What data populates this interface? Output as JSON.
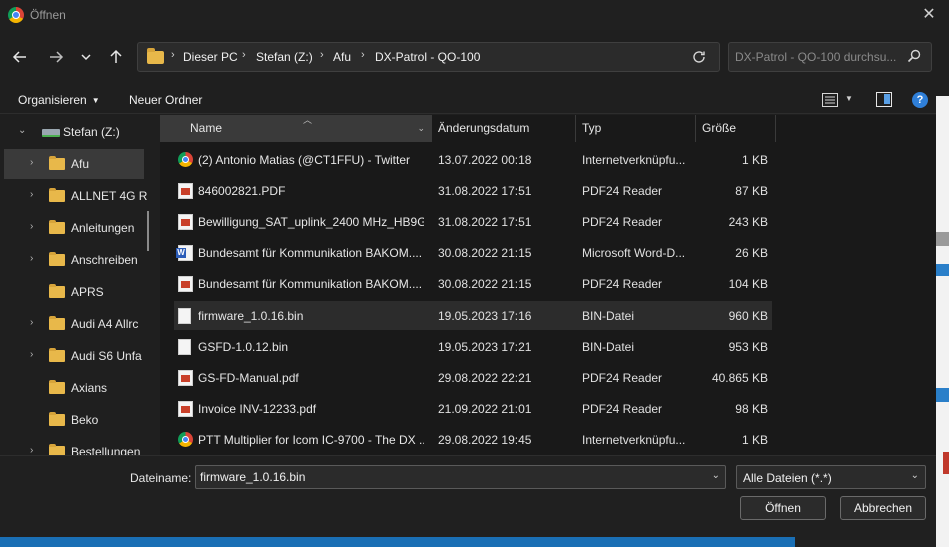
{
  "window": {
    "title": "Öffnen",
    "close_glyph": "✕"
  },
  "nav": {
    "back_glyph": "🡐",
    "forward_glyph": "🡒",
    "recent_glyph": "⌄",
    "up_glyph": "🡑",
    "breadcrumbs": [
      "Dieser PC",
      "Stefan (Z:)",
      "Afu",
      "DX-Patrol - QO-100"
    ],
    "separator": "›",
    "refresh_glyph": "↻",
    "search_placeholder": "DX-Patrol - QO-100 durchsu..."
  },
  "toolbar": {
    "organize_label": "Organisieren",
    "new_folder_label": "Neuer Ordner",
    "help_label": "?"
  },
  "sidebar": {
    "items": [
      {
        "label": "Stefan (Z:)",
        "expanded": true,
        "kind": "drive"
      },
      {
        "label": "Afu",
        "selected": true,
        "has_children": true
      },
      {
        "label": "ALLNET 4G R",
        "has_children": true
      },
      {
        "label": "Anleitungen",
        "has_children": true
      },
      {
        "label": "Anschreiben",
        "has_children": true
      },
      {
        "label": "APRS",
        "has_children": false
      },
      {
        "label": "Audi A4 Allrc",
        "has_children": true
      },
      {
        "label": "Audi S6 Unfa",
        "has_children": true
      },
      {
        "label": "Axians",
        "has_children": false
      },
      {
        "label": "Beko",
        "has_children": false
      },
      {
        "label": "Bestellungen",
        "has_children": true
      }
    ]
  },
  "file_list": {
    "columns": {
      "name": "Name",
      "date": "Änderungsdatum",
      "type": "Typ",
      "size": "Größe"
    },
    "rows": [
      {
        "icon": "chrome-icon",
        "name": "(2) Antonio Matias (@CT1FFU) - Twitter",
        "date": "13.07.2022 00:18",
        "type": "Internetverknüpfu...",
        "size": "1 KB"
      },
      {
        "icon": "pdf-icon",
        "name": "846002821.PDF",
        "date": "31.08.2022 17:51",
        "type": "PDF24 Reader",
        "size": "87 KB"
      },
      {
        "icon": "pdf-icon",
        "name": "Bewilligung_SAT_uplink_2400 MHz_HB9G...",
        "date": "31.08.2022 17:51",
        "type": "PDF24 Reader",
        "size": "243 KB"
      },
      {
        "icon": "word-icon",
        "name": "Bundesamt für Kommunikation BAKOM....",
        "date": "30.08.2022 21:15",
        "type": "Microsoft Word-D...",
        "size": "26 KB"
      },
      {
        "icon": "pdf-icon",
        "name": "Bundesamt für Kommunikation BAKOM....",
        "date": "30.08.2022 21:15",
        "type": "PDF24 Reader",
        "size": "104 KB"
      },
      {
        "icon": "file-icon",
        "name": "firmware_1.0.16.bin",
        "date": "19.05.2023 17:16",
        "type": "BIN-Datei",
        "size": "960 KB",
        "hover": true
      },
      {
        "icon": "file-icon",
        "name": "GSFD-1.0.12.bin",
        "date": "19.05.2023 17:21",
        "type": "BIN-Datei",
        "size": "953 KB"
      },
      {
        "icon": "pdf-icon",
        "name": "GS-FD-Manual.pdf",
        "date": "29.08.2022 22:21",
        "type": "PDF24 Reader",
        "size": "40.865 KB"
      },
      {
        "icon": "pdf-icon",
        "name": "Invoice INV-12233.pdf",
        "date": "21.09.2022 21:01",
        "type": "PDF24 Reader",
        "size": "98 KB"
      },
      {
        "icon": "chrome-icon",
        "name": "PTT Multiplier for Icom IC-9700 - The DX ...",
        "date": "29.08.2022 19:45",
        "type": "Internetverknüpfu...",
        "size": "1 KB"
      }
    ]
  },
  "bottom": {
    "filename_label": "Dateiname:",
    "filename_value": "firmware_1.0.16.bin",
    "filetype_value": "Alle Dateien (*.*)",
    "open_label": "Öffnen",
    "cancel_label": "Abbrechen"
  },
  "colors": {
    "background": "#1f1f1f",
    "list_background": "#191919",
    "folder": "#e8b84a",
    "accent": "#2f7fd8"
  }
}
